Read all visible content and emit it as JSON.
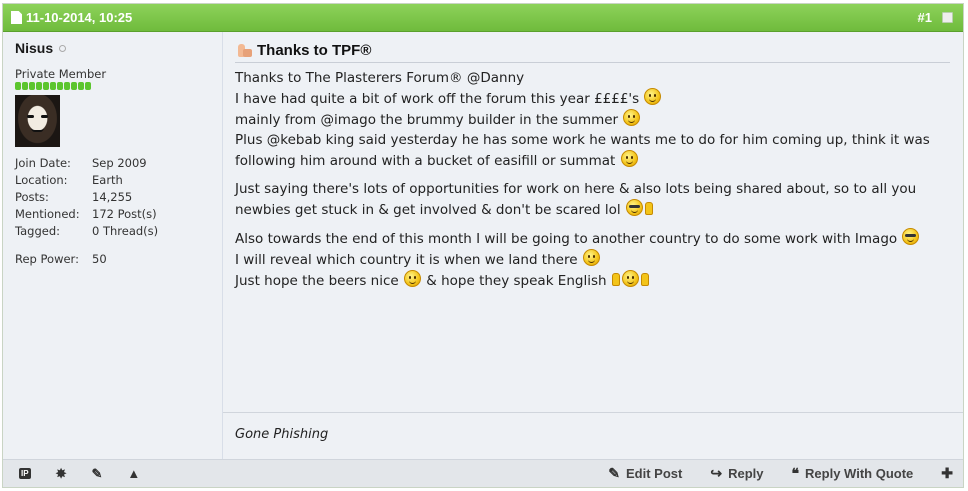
{
  "post": {
    "date": "11-10-2014, 10:25",
    "number": "#1"
  },
  "user": {
    "name": "Nisus",
    "title": "Private Member",
    "rep_pips": 11,
    "stats": [
      {
        "label": "Join Date:",
        "value": "Sep 2009"
      },
      {
        "label": "Location:",
        "value": "Earth"
      },
      {
        "label": "Posts:",
        "value": "14,255"
      },
      {
        "label": "Mentioned:",
        "value": "172 Post(s)"
      },
      {
        "label": "Tagged:",
        "value": "0 Thread(s)"
      }
    ],
    "rep_power_label": "Rep Power:",
    "rep_power_value": "50"
  },
  "message": {
    "title": "Thanks to TPF®",
    "lines": {
      "l1": "Thanks to The Plasterers Forum® @Danny",
      "l2": "I have had quite a bit of work off the forum this year ££££'s",
      "l3": "mainly from @imago the brummy builder in the summer",
      "l4": "Plus @kebab king said yesterday he has some work he wants me to do for him coming up, think it was following him around with a bucket of easifill or summat",
      "l5": "Just saying there's lots of opportunities for work on here & also lots being shared about, so to all you newbies get stuck in & get involved & don't be scared lol",
      "l6": "Also towards the end of this month I will be going to another country to do some work with Imago",
      "l7": "I will reveal which country it is when we land there",
      "l8a": "Just hope the beers nice",
      "l8b": "& hope they speak English"
    },
    "signature": "Gone Phishing"
  },
  "footer": {
    "edit": "Edit Post",
    "reply": "Reply",
    "reply_quote": "Reply With Quote"
  },
  "icons": {
    "header": "document-icon",
    "title": "thumbs-up-icon",
    "footer_left": [
      "ip-icon",
      "star-report-icon",
      "infraction-icon",
      "warning-icon"
    ],
    "footer_right": [
      "pencil-icon",
      "reply-arrow-icon",
      "quote-icon",
      "multiquote-icon"
    ]
  },
  "colors": {
    "header_bg": "#7cc54a",
    "body_bg": "#eef1f5",
    "rep_pip": "#5cc52e"
  }
}
